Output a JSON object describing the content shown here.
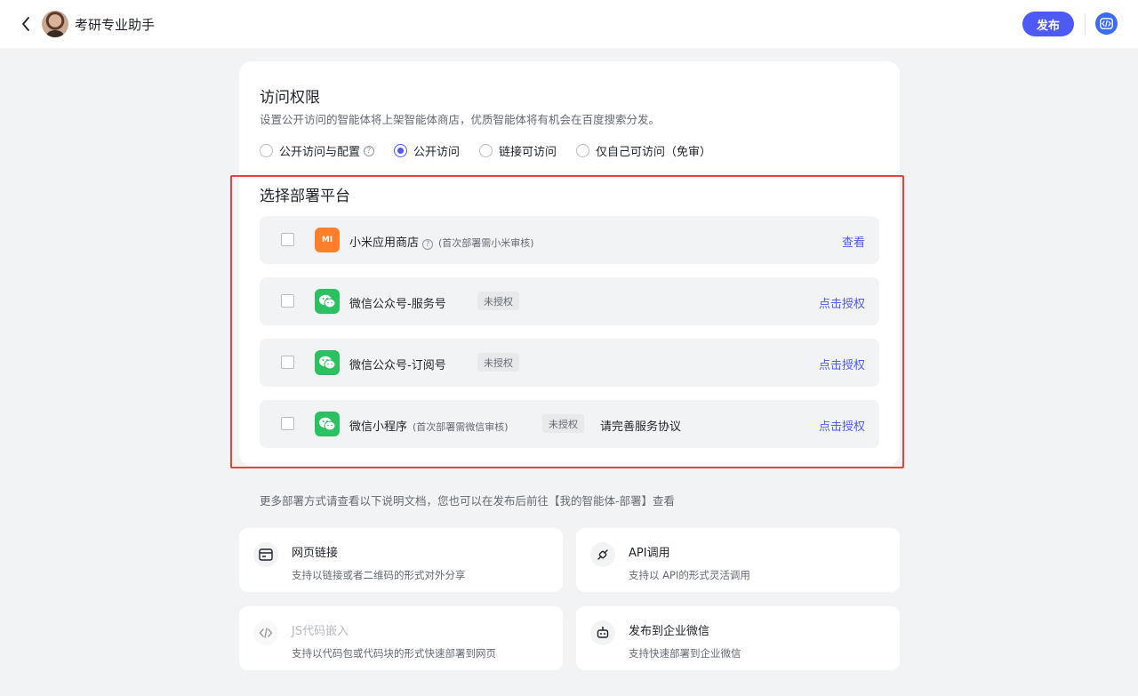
{
  "header": {
    "title": "考研专业助手",
    "publish_label": "发布"
  },
  "access": {
    "title": "访问权限",
    "desc": "设置公开访问的智能体将上架智能体商店，优质智能体将有机会在百度搜索分发。",
    "options": [
      {
        "label": "公开访问与配置",
        "checked": false
      },
      {
        "label": "公开访问",
        "checked": true
      },
      {
        "label": "链接可访问",
        "checked": false
      },
      {
        "label": "仅自己可访问（免审）",
        "checked": false
      }
    ]
  },
  "deploy": {
    "title": "选择部署平台",
    "platforms": [
      {
        "name": "小米应用商店",
        "note": "(首次部署需小米审核)",
        "tag": "",
        "extra": "",
        "link": "查看",
        "logo_text": "MI"
      },
      {
        "name": "微信公众号-服务号",
        "note": "",
        "tag": "未授权",
        "extra": "",
        "link": "点击授权"
      },
      {
        "name": "微信公众号-订阅号",
        "note": "",
        "tag": "未授权",
        "extra": "",
        "link": "点击授权"
      },
      {
        "name": "微信小程序",
        "note": "(首次部署需微信审核)",
        "tag": "未授权",
        "extra": "请完善服务协议",
        "link": "点击授权"
      }
    ]
  },
  "more_text": "更多部署方式请查看以下说明文档，您也可以在发布后前往【我的智能体-部署】查看",
  "methods": [
    {
      "title": "网页链接",
      "desc": "支持以链接或者二维码的形式对外分享"
    },
    {
      "title": "API调用",
      "desc": "支持以 API的形式灵活调用"
    },
    {
      "title": "JS代码嵌入",
      "desc": "支持以代码包或代码块的形式快速部署到网页"
    },
    {
      "title": "发布到企业微信",
      "desc": "支持快速部署到企业微信"
    }
  ],
  "colors": {
    "accent": "#4e5af5",
    "highlight": "#e8423b",
    "wechat": "#2bc160",
    "xiaomi": "#ff7f2a"
  }
}
